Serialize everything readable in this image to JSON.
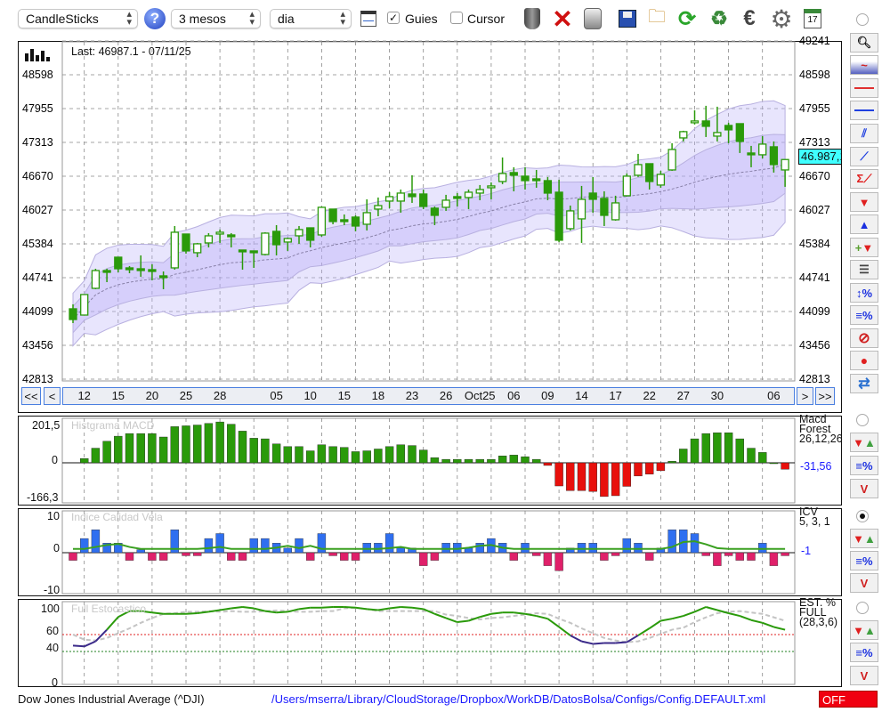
{
  "toolbar": {
    "chart_type": "CandleSticks",
    "period": "3 mesos",
    "interval": "dia",
    "guides_label": "Guies",
    "guides_checked": true,
    "cursor_label": "Cursor",
    "cursor_checked": false,
    "check_mark": "✓"
  },
  "main": {
    "last_label": "Last: 46987.1 - 07/11/25",
    "price_tag": "46.987,1",
    "nav": {
      "first": "<<",
      "prev": "<",
      "next": ">",
      "last": ">>"
    }
  },
  "panels": {
    "macd": {
      "top": "201,5",
      "zero": "0",
      "bottom": "-166,3",
      "name1": "Macd",
      "name2": "Forest",
      "params": "26,12,26",
      "value": "-31,56"
    },
    "icv": {
      "top": "10",
      "zero": "0",
      "bottom": "-10",
      "name1": "ICV",
      "params": "5, 3, 1",
      "value": "-1"
    },
    "stoch": {
      "t100": "100",
      "t60": "60",
      "t40": "40",
      "t0": "0",
      "name1": "EST. %",
      "name2": "FULL",
      "params": "(28,3,6)"
    }
  },
  "footer": {
    "symbol": "Dow Jones Industrial Average (^DJI)",
    "config_path": "/Users/mserra/Library/CloudStorage/Dropbox/WorkDB/DatosBolsa/Configs/Config.DEFAULT.xml",
    "status": "OFF"
  },
  "colors": {
    "up_down_candle": "#2a9a0a",
    "macd_pos": "#2a9a0a",
    "macd_neg": "#e8100c",
    "icv_pos": "#2f6ff0",
    "icv_neg": "#e0206a",
    "stoch_main": "#2a9a0a",
    "stoch_low": "#3b2a8a",
    "price_tag": "#40ffff",
    "link": "#1a1aff"
  },
  "chart_data": [
    {
      "type": "candlestick",
      "ylim": [
        42813,
        49241
      ],
      "yticks": [
        49241,
        48598,
        47955,
        47313,
        46670,
        46027,
        45384,
        44741,
        44099,
        43456,
        42813
      ],
      "xticks": [
        {
          "label": "12",
          "index": 2
        },
        {
          "label": "15",
          "index": 5
        },
        {
          "label": "20",
          "index": 8
        },
        {
          "label": "25",
          "index": 11
        },
        {
          "label": "28",
          "index": 14
        },
        {
          "label": "05",
          "index": 19
        },
        {
          "label": "10",
          "index": 22
        },
        {
          "label": "15",
          "index": 25
        },
        {
          "label": "18",
          "index": 28
        },
        {
          "label": "23",
          "index": 31
        },
        {
          "label": "26",
          "index": 34
        },
        {
          "label": "Oct25",
          "index": 37
        },
        {
          "label": "06",
          "index": 40
        },
        {
          "label": "09",
          "index": 43
        },
        {
          "label": "14",
          "index": 46
        },
        {
          "label": "17",
          "index": 49
        },
        {
          "label": "22",
          "index": 52
        },
        {
          "label": "27",
          "index": 55
        },
        {
          "label": "30",
          "index": 58
        },
        {
          "label": "06",
          "index": 63
        }
      ],
      "overlay": "bollinger-bands",
      "grid": true,
      "last_price": 46987.1,
      "ohlc": [
        [
          44150,
          44235,
          43879,
          43946
        ],
        [
          44031,
          44421,
          44031,
          44421
        ],
        [
          44539,
          44911,
          44522,
          44877
        ],
        [
          44877,
          44911,
          44657,
          44877
        ],
        [
          45131,
          45131,
          44843,
          44911
        ],
        [
          44928,
          44962,
          44826,
          44894
        ],
        [
          44911,
          45165,
          44759,
          44894
        ],
        [
          44894,
          44996,
          44691,
          44894
        ],
        [
          44776,
          44860,
          44522,
          44742
        ],
        [
          44928,
          45723,
          44894,
          45605
        ],
        [
          45571,
          45571,
          45199,
          45250
        ],
        [
          45216,
          45402,
          45131,
          45385
        ],
        [
          45402,
          45588,
          45317,
          45537
        ],
        [
          45571,
          45656,
          45402,
          45605
        ],
        [
          45554,
          45588,
          45317,
          45520
        ],
        [
          45267,
          45267,
          44894,
          45267
        ],
        [
          45250,
          45250,
          44928,
          45250
        ],
        [
          45182,
          45605,
          45165,
          45588
        ],
        [
          45622,
          45740,
          45165,
          45368
        ],
        [
          45419,
          45503,
          45250,
          45486
        ],
        [
          45537,
          45723,
          45385,
          45656
        ],
        [
          45689,
          45689,
          45317,
          45453
        ],
        [
          45554,
          46095,
          45520,
          46079
        ],
        [
          46045,
          46045,
          45757,
          45808
        ],
        [
          45842,
          45943,
          45740,
          45808
        ],
        [
          45893,
          45926,
          45622,
          45723
        ],
        [
          45757,
          46231,
          45639,
          45977
        ],
        [
          46045,
          46265,
          45909,
          46112
        ],
        [
          46197,
          46366,
          46062,
          46282
        ],
        [
          46197,
          46417,
          45977,
          46349
        ],
        [
          46332,
          46688,
          46163,
          46282
        ],
        [
          46332,
          46417,
          46045,
          46095
        ],
        [
          46062,
          46095,
          45740,
          45926
        ],
        [
          46079,
          46316,
          46011,
          46214
        ],
        [
          46282,
          46349,
          46095,
          46282
        ],
        [
          46265,
          46417,
          46045,
          46366
        ],
        [
          46349,
          46502,
          46214,
          46417
        ],
        [
          46451,
          46552,
          46231,
          46485
        ],
        [
          46569,
          47026,
          46519,
          46722
        ],
        [
          46739,
          46840,
          46383,
          46688
        ],
        [
          46671,
          46840,
          46417,
          46586
        ],
        [
          46620,
          46789,
          46451,
          46586
        ],
        [
          46586,
          46654,
          46214,
          46349
        ],
        [
          46366,
          46603,
          45419,
          45453
        ],
        [
          45673,
          46112,
          45639,
          46011
        ],
        [
          45859,
          46485,
          45402,
          46231
        ],
        [
          46349,
          46654,
          45977,
          46231
        ],
        [
          46248,
          46383,
          45723,
          45926
        ],
        [
          45842,
          46299,
          45825,
          46163
        ],
        [
          46299,
          46722,
          46282,
          46671
        ],
        [
          46688,
          47094,
          46654,
          46891
        ],
        [
          46908,
          46908,
          46417,
          46569
        ],
        [
          46502,
          46772,
          46451,
          46705
        ],
        [
          46789,
          47297,
          46772,
          47178
        ],
        [
          47398,
          47534,
          47331,
          47517
        ],
        [
          47703,
          47923,
          47652,
          47720
        ],
        [
          47720,
          48008,
          47415,
          47618
        ],
        [
          47432,
          47991,
          47331,
          47500
        ],
        [
          47635,
          47686,
          47297,
          47551
        ],
        [
          47669,
          47669,
          47111,
          47331
        ],
        [
          47111,
          47246,
          46840,
          47077
        ],
        [
          47077,
          47432,
          47009,
          47280
        ],
        [
          47229,
          47331,
          46739,
          46891
        ],
        [
          46789,
          46987,
          46468,
          46987
        ]
      ]
    },
    {
      "type": "bar",
      "title": "Histgrama MACD",
      "ylim": [
        -166.3,
        201.5
      ],
      "values": [
        null,
        21,
        72,
        106,
        131,
        144,
        144,
        144,
        127,
        178,
        182,
        186,
        194,
        201,
        190,
        156,
        121,
        118,
        93,
        80,
        80,
        59,
        89,
        80,
        76,
        55,
        59,
        68,
        80,
        89,
        85,
        63,
        25,
        17,
        17,
        17,
        17,
        17,
        34,
        38,
        30,
        17,
        -13,
        -114,
        -137,
        -137,
        -141,
        -166,
        -162,
        -116,
        -65,
        -56,
        -39,
        8,
        68,
        118,
        144,
        148,
        148,
        118,
        72,
        51,
        0,
        -31.56
      ]
    },
    {
      "type": "bar",
      "title": "Indice Calidad Vela",
      "ylim": [
        -10,
        10
      ],
      "values": [
        -2,
        3.7,
        6,
        2.5,
        2.5,
        -2,
        0.8,
        -2,
        -2,
        6,
        -0.8,
        -0.8,
        3.7,
        5,
        -2,
        -2,
        3.7,
        3.7,
        2.5,
        1.2,
        3.7,
        -2,
        5,
        -0.8,
        -2,
        -2,
        2.5,
        2.5,
        5,
        1.2,
        1.2,
        -3.4,
        -2,
        2.5,
        2.5,
        1.2,
        2.5,
        3.7,
        2.5,
        -2,
        2.5,
        -0.8,
        -3.4,
        -4.7,
        1.2,
        2.5,
        2.5,
        -2,
        -0.8,
        3.7,
        2.5,
        -2,
        1.2,
        6,
        6,
        5,
        -0.8,
        -3.4,
        -0.8,
        -2,
        -2,
        2.5,
        -3.4,
        -0.8
      ],
      "signal": [
        1,
        1,
        1.5,
        2,
        2.3,
        1.5,
        1,
        1,
        1,
        1,
        1,
        1,
        1.2,
        1.5,
        1,
        1,
        1,
        1,
        1.3,
        1.8,
        1.2,
        1.8,
        1,
        1,
        1,
        1,
        1,
        1,
        1.2,
        1.5,
        1,
        1,
        1,
        1,
        1,
        1.3,
        1.8,
        2,
        1.3,
        1,
        1,
        1,
        1,
        1,
        1,
        1,
        1,
        1,
        1,
        1,
        1,
        1,
        1,
        1.5,
        2.8,
        3,
        2.2,
        1.2,
        1,
        1,
        1,
        1,
        1,
        1
      ]
    },
    {
      "type": "line",
      "title": "Full Estocastico",
      "ylim": [
        0,
        100
      ],
      "levels": [
        60,
        40
      ],
      "series": [
        {
          "values": [
            47,
            46,
            52,
            67,
            85.5,
            94,
            94,
            92,
            90,
            90,
            90,
            91,
            93,
            95.5,
            98,
            100,
            98,
            94,
            92,
            93,
            97,
            99,
            99,
            100,
            100,
            99,
            97,
            95.5,
            98,
            100,
            99,
            97,
            90,
            84,
            78,
            80,
            85.5,
            90,
            92,
            92,
            90,
            87,
            83,
            71,
            59,
            52,
            49,
            50,
            50,
            51,
            59,
            69,
            80,
            83,
            87,
            93,
            100,
            95.5,
            91,
            87,
            81,
            77,
            71,
            67
          ]
        },
        {
          "values": [
            60,
            54,
            53,
            56,
            62,
            69,
            77,
            84,
            90,
            91,
            93,
            93,
            94,
            93,
            94,
            93,
            93,
            94,
            95,
            94,
            93,
            93,
            94,
            94,
            98,
            99,
            97,
            94,
            94,
            94,
            94,
            94,
            94,
            89,
            87,
            84,
            82,
            84,
            85,
            87,
            89,
            91,
            90,
            83,
            77,
            69,
            62,
            56,
            53,
            51,
            52,
            56,
            61,
            67,
            70,
            78,
            85,
            91,
            93,
            94,
            92,
            90,
            85,
            80
          ]
        }
      ]
    }
  ]
}
